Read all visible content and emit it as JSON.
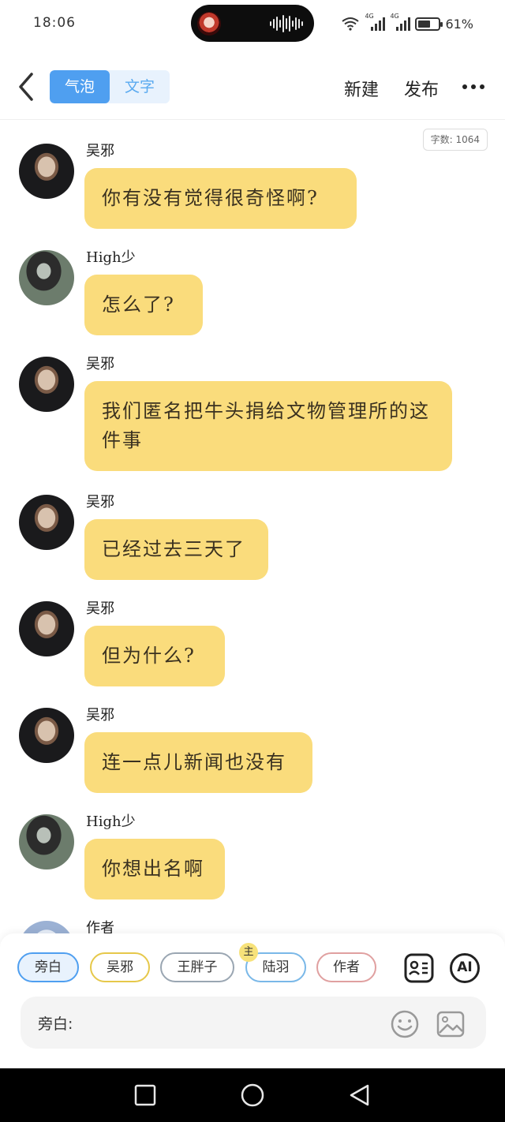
{
  "status_bar": {
    "time": "18:06",
    "network_1": "4G",
    "network_2": "4G",
    "battery": "61%",
    "battery_level": 0.61
  },
  "header": {
    "tabs": [
      {
        "label": "气泡",
        "active": true
      },
      {
        "label": "文字",
        "active": false
      }
    ],
    "new_label": "新建",
    "publish_label": "发布"
  },
  "word_count": "字数: 1064",
  "messages": [
    {
      "speaker": "吴邪",
      "avatar": "wuxie",
      "text": "你有没有觉得很奇怪啊?"
    },
    {
      "speaker": "High少",
      "avatar": "high",
      "text": "怎么了?"
    },
    {
      "speaker": "吴邪",
      "avatar": "wuxie",
      "text": "我们匿名把牛头捐给文物管理所的这件事"
    },
    {
      "speaker": "吴邪",
      "avatar": "wuxie",
      "text": "已经过去三天了"
    },
    {
      "speaker": "吴邪",
      "avatar": "wuxie",
      "text": "但为什么?"
    },
    {
      "speaker": "吴邪",
      "avatar": "wuxie",
      "text": "连一点儿新闻也没有"
    },
    {
      "speaker": "High少",
      "avatar": "high",
      "text": "你想出名啊"
    },
    {
      "speaker": "作者",
      "avatar": "author",
      "text": ""
    }
  ],
  "characters": [
    {
      "label": "旁白",
      "selected": true,
      "color": "#4f9ff0"
    },
    {
      "label": "吴邪",
      "selected": false,
      "color": "#e6c84a"
    },
    {
      "label": "王胖子",
      "selected": false,
      "color": "#9aa6b2"
    },
    {
      "label": "陆羽",
      "selected": false,
      "color": "#7ab8e8",
      "badge": "主"
    },
    {
      "label": "作者",
      "selected": false,
      "color": "#e0a0a0"
    }
  ],
  "tools": {
    "character_card_icon": "character-card-icon",
    "ai_label": "AI"
  },
  "input": {
    "label": "旁白:",
    "value": "",
    "placeholder": ""
  },
  "colors": {
    "accent": "#4f9ff0",
    "bubble": "#fadc7c"
  }
}
